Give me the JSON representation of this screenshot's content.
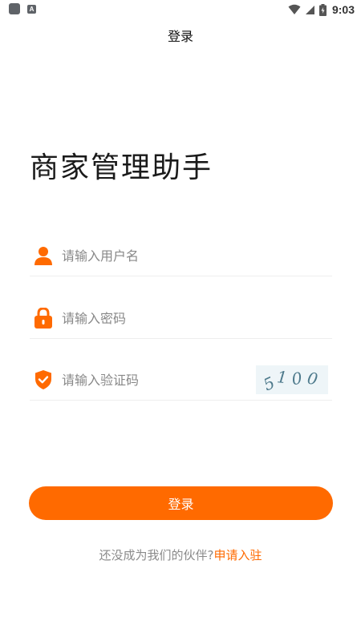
{
  "status_bar": {
    "notification_badge": "A",
    "time": "9:03"
  },
  "header": {
    "title": "登录"
  },
  "app": {
    "title": "商家管理助手"
  },
  "form": {
    "username": {
      "placeholder": "请输入用户名",
      "value": "",
      "icon": "user-icon"
    },
    "password": {
      "placeholder": "请输入密码",
      "value": "",
      "icon": "lock-icon"
    },
    "captcha": {
      "placeholder": "请输入验证码",
      "value": "",
      "icon": "shield-check-icon",
      "code": [
        "5",
        "1",
        "0",
        "0"
      ]
    },
    "submit_label": "登录"
  },
  "footer": {
    "question": "还没成为我们的伙伴?",
    "apply_link": "申请入驻"
  },
  "colors": {
    "accent": "#ff6a00",
    "captcha_bg": "#eef5f8",
    "captcha_text": "#4e7a8c"
  }
}
